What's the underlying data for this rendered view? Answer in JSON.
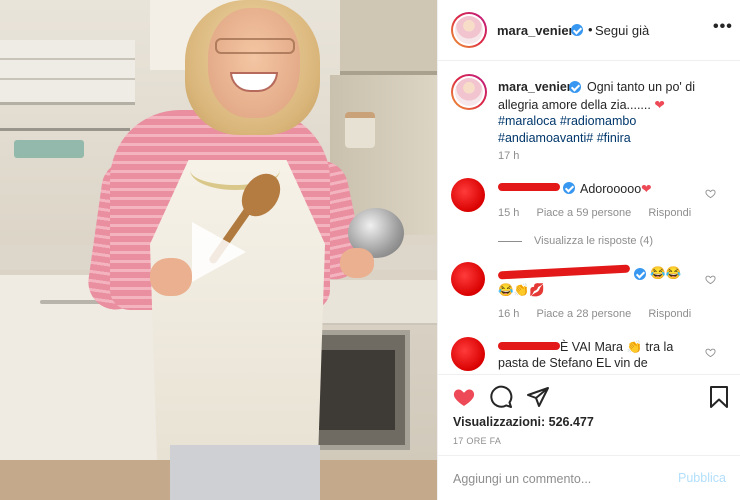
{
  "post": {
    "username": "mara_venier",
    "follow_status": "Segui già",
    "more_icon": "more-horizontal-icon"
  },
  "caption": {
    "username": "mara_venier",
    "text": "Ogni tanto un po' di",
    "line2": "allegria amore della zia.......",
    "heart": "❤",
    "line3_tag1": "#maraloca",
    "line3_tag2": "#radiomambo",
    "line4_tag1": "#andiamoavanti#",
    "line4_tag2": "#finira",
    "time": "17 h"
  },
  "comments": [
    {
      "text": "Adorooooo",
      "emoji": "❤",
      "time": "15 h",
      "likes": "Piace a 59 persone",
      "reply": "Rispondi",
      "view_replies": "Visualizza le risposte (4)"
    },
    {
      "emoji_line1": "😂😂",
      "emoji_line2": "😂👏💋",
      "time": "16 h",
      "likes": "Piace a 28 persone",
      "reply": "Rispondi"
    },
    {
      "text_line1": "È VAI Mara 👏 tra la",
      "text_line2": "pasta de Stefano EL vin de"
    }
  ],
  "actions": {
    "views_label": "Visualizzazioni:",
    "views_count": "526.477",
    "ago": "17 ORE FA",
    "comment_placeholder": "Aggiungi un commento...",
    "publish_label": "Pubblica"
  },
  "colors": {
    "verified": "#3897f0",
    "like_red": "#ed4956",
    "hashtag": "#00376b",
    "publish_disabled": "#b2dffc"
  }
}
